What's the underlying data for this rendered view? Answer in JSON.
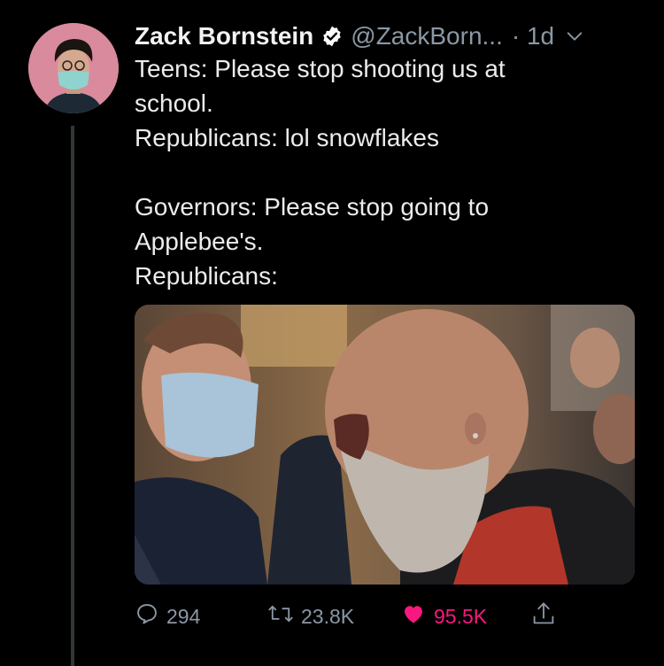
{
  "tweet": {
    "author_name": "Zack Bornstein",
    "handle": "@ZackBorn...",
    "time": "· 1d",
    "lines": [
      "Teens: Please stop shooting us at",
      "school.",
      "Republicans: lol snowflakes",
      "",
      "Governors: Please stop going to",
      "Applebee's.",
      "Republicans:"
    ]
  },
  "actions": {
    "replies": "294",
    "retweets": "23.8K",
    "likes": "95.5K"
  },
  "colors": {
    "background": "#000000",
    "text": "#e7e9ea",
    "secondary_text": "#8b98a5",
    "like": "#f91880",
    "verified_badge": "#ffffff"
  },
  "icons": [
    "verified-icon",
    "chevron-down-icon",
    "reply-icon",
    "retweet-icon",
    "heart-icon",
    "share-icon"
  ]
}
